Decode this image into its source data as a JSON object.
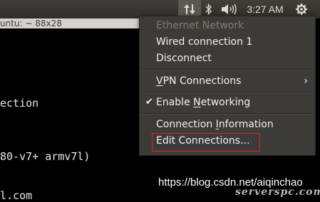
{
  "panel": {
    "network_icon": "network-updown-icon",
    "bluetooth_icon": "bluetooth-icon",
    "sound_icon": "speaker-icon",
    "clock": "3:27 AM",
    "session_icon": "gear-icon"
  },
  "terminal": {
    "title": "untu: ~ 88x28",
    "lines": [
      "ection",
      "80-v7+ armv7l)",
      "l.com"
    ]
  },
  "menu": {
    "header": "Ethernet Network",
    "wired": "Wired connection 1",
    "disconnect": "Disconnect",
    "vpn_prefix": "",
    "vpn_u": "V",
    "vpn_rest": "PN Connections",
    "submenu_arrow": "›",
    "check": "✔",
    "enable_a": "Enable ",
    "enable_u": "N",
    "enable_b": "etworking",
    "info_a": "Connection ",
    "info_u": "I",
    "info_b": "nformation",
    "edit": "Edit Connections..."
  },
  "watermark": {
    "url": "https://blog.csdn.net/aiqinchao",
    "site": "serverspc.com"
  }
}
